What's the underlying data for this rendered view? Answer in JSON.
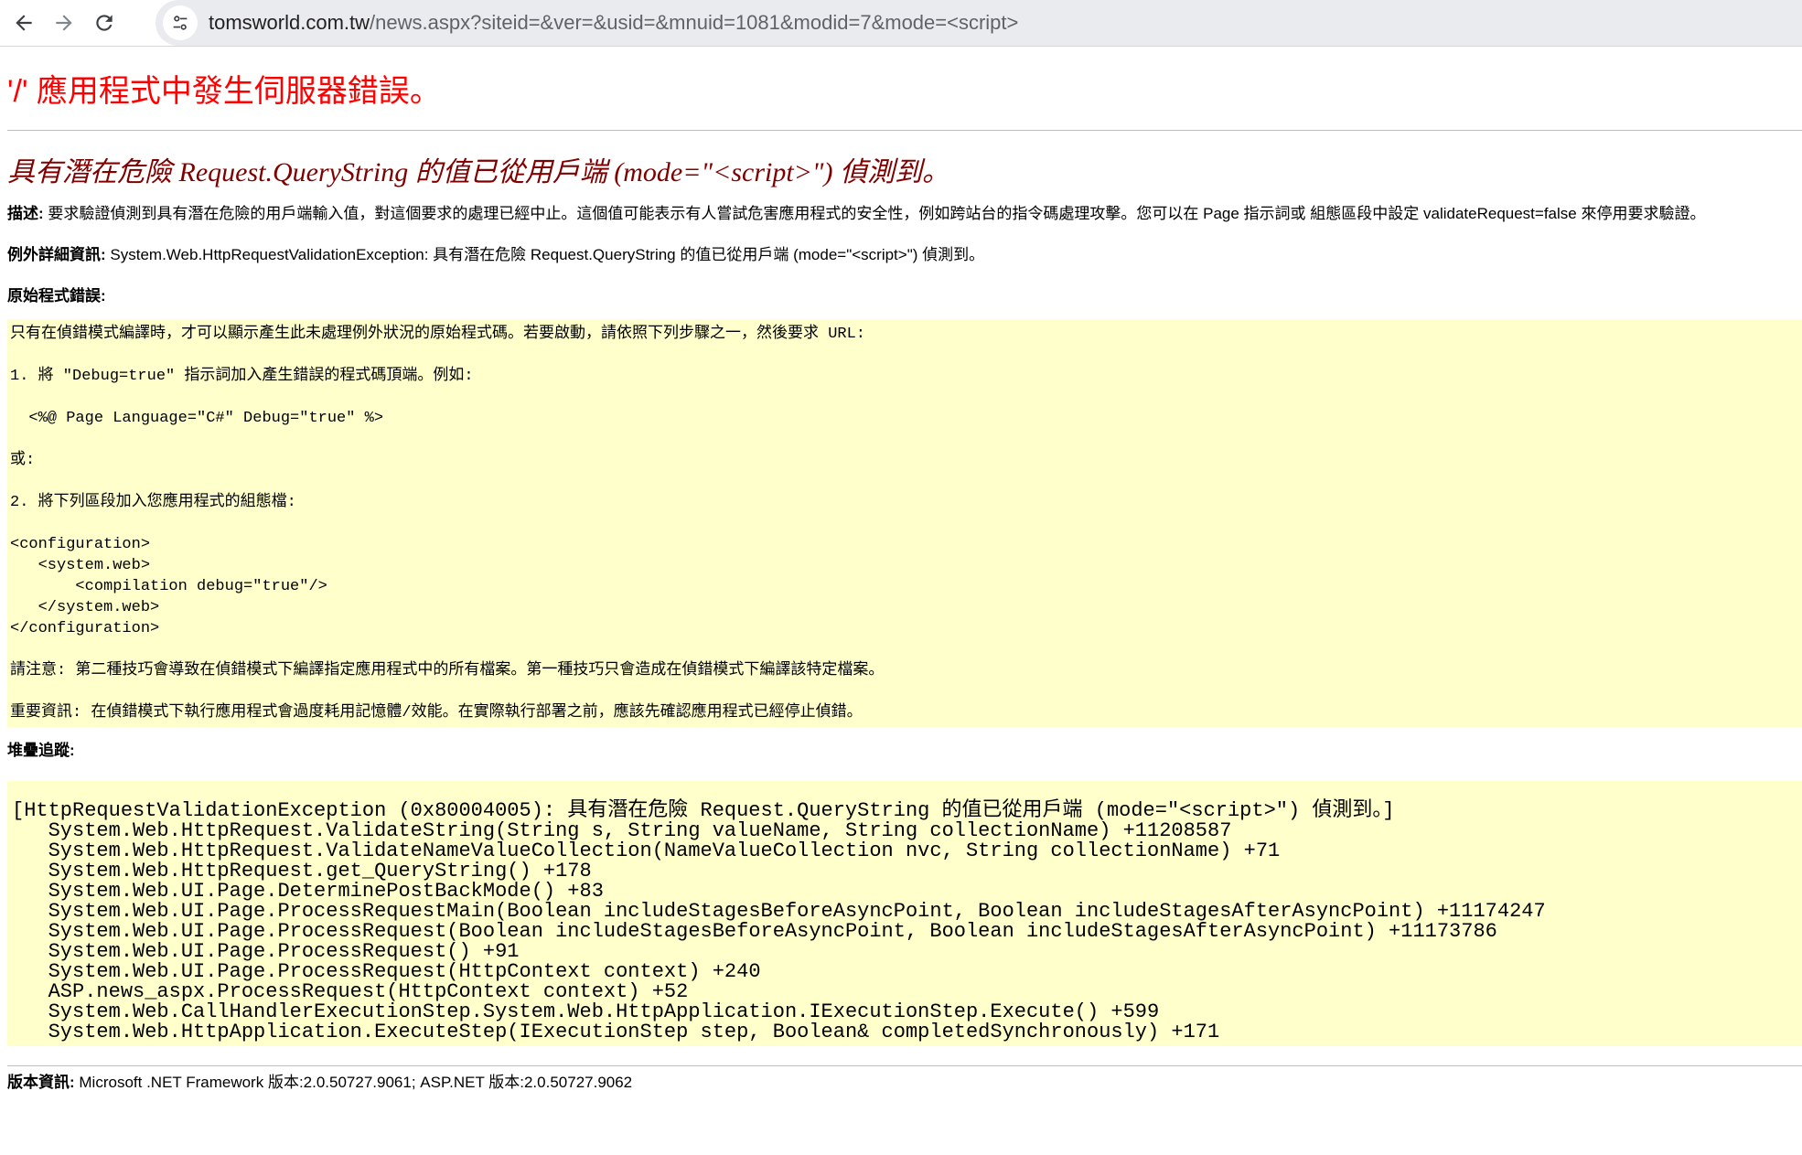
{
  "browser": {
    "url_host": "tomsworld.com.tw",
    "url_rest": "/news.aspx?siteid=&ver=&usid=&mnuid=1081&modid=7&mode=<script>"
  },
  "error": {
    "title": "'/' 應用程式中發生伺服器錯誤。",
    "subtitle": "具有潛在危險 Request.QueryString 的值已從用戶端 (mode=\"<script>\") 偵測到。",
    "description_label": "描述:",
    "description_text": " 要求驗證偵測到具有潛在危險的用戶端輸入值，對這個要求的處理已經中止。這個值可能表示有人嘗試危害應用程式的安全性，例如跨站台的指令碼處理攻擊。您可以在 Page 指示詞或 組態區段中設定 validateRequest=false 來停用要求驗證。",
    "exception_label": "例外詳細資訊:",
    "exception_text": " System.Web.HttpRequestValidationException: 具有潛在危險 Request.QueryString 的值已從用戶端 (mode=\"<script>\") 偵測到。",
    "source_label": "原始程式錯誤:",
    "source_lines": [
      "只有在偵錯模式編譯時，才可以顯示產生此未處理例外狀況的原始程式碼。若要啟動，請依照下列步驟之一，然後要求 URL:",
      "",
      "1. 將 \"Debug=true\" 指示詞加入產生錯誤的程式碼頂端。例如:",
      "",
      "  <%@ Page Language=\"C#\" Debug=\"true\" %>",
      "",
      "或:",
      "",
      "2. 將下列區段加入您應用程式的組態檔:",
      "",
      "<configuration>",
      "   <system.web>",
      "       <compilation debug=\"true\"/>",
      "   </system.web>",
      "</configuration>",
      "",
      "請注意: 第二種技巧會導致在偵錯模式下編譯指定應用程式中的所有檔案。第一種技巧只會造成在偵錯模式下編譯該特定檔案。",
      "",
      "重要資訊: 在偵錯模式下執行應用程式會過度耗用記憶體/效能。在實際執行部署之前，應該先確認應用程式已經停止偵錯。"
    ],
    "stack_label": "堆疊追蹤:",
    "stack_lines": [
      "[HttpRequestValidationException (0x80004005): 具有潛在危險 Request.QueryString 的值已從用戶端 (mode=\"<script>\") 偵測到。]",
      "   System.Web.HttpRequest.ValidateString(String s, String valueName, String collectionName) +11208587",
      "   System.Web.HttpRequest.ValidateNameValueCollection(NameValueCollection nvc, String collectionName) +71",
      "   System.Web.HttpRequest.get_QueryString() +178",
      "   System.Web.UI.Page.DeterminePostBackMode() +83",
      "   System.Web.UI.Page.ProcessRequestMain(Boolean includeStagesBeforeAsyncPoint, Boolean includeStagesAfterAsyncPoint) +11174247",
      "   System.Web.UI.Page.ProcessRequest(Boolean includeStagesBeforeAsyncPoint, Boolean includeStagesAfterAsyncPoint) +11173786",
      "   System.Web.UI.Page.ProcessRequest() +91",
      "   System.Web.UI.Page.ProcessRequest(HttpContext context) +240",
      "   ASP.news_aspx.ProcessRequest(HttpContext context) +52",
      "   System.Web.CallHandlerExecutionStep.System.Web.HttpApplication.IExecutionStep.Execute() +599",
      "   System.Web.HttpApplication.ExecuteStep(IExecutionStep step, Boolean& completedSynchronously) +171"
    ],
    "version_label": "版本資訊:",
    "version_text": " Microsoft .NET Framework 版本:2.0.50727.9061; ASP.NET 版本:2.0.50727.9062"
  },
  "colors": {
    "title": "#ff0000",
    "subtitle": "#800000",
    "code_bg": "#ffffcc"
  },
  "icons": {
    "back": "arrow-left-icon",
    "forward": "arrow-right-icon",
    "reload": "reload-icon",
    "site_info": "tune-icon"
  }
}
